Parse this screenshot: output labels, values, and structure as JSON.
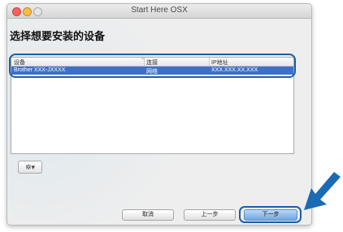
{
  "window": {
    "title": "Start Here OSX"
  },
  "page": {
    "title": "选择想要安装的设备"
  },
  "device_table": {
    "columns": [
      "设备",
      "连接",
      "IP地址"
    ],
    "sort_indicator": "⌃",
    "rows": [
      {
        "device": "Brother XXX-JXXXX",
        "connection": "网络",
        "ip": "XXX.XXX.XX.XXX",
        "selected": true
      }
    ]
  },
  "toolbar": {
    "action_menu_label": "✲▾"
  },
  "buttons": {
    "cancel": "取消",
    "back": "上一步",
    "next": "下一步"
  },
  "colors": {
    "selection": "#3f70c8",
    "highlight_outline": "#1a5ea8",
    "arrow": "#1a6bb3"
  },
  "icons": {
    "gear": "gear-icon",
    "arrow": "arrow-pointer-icon"
  }
}
